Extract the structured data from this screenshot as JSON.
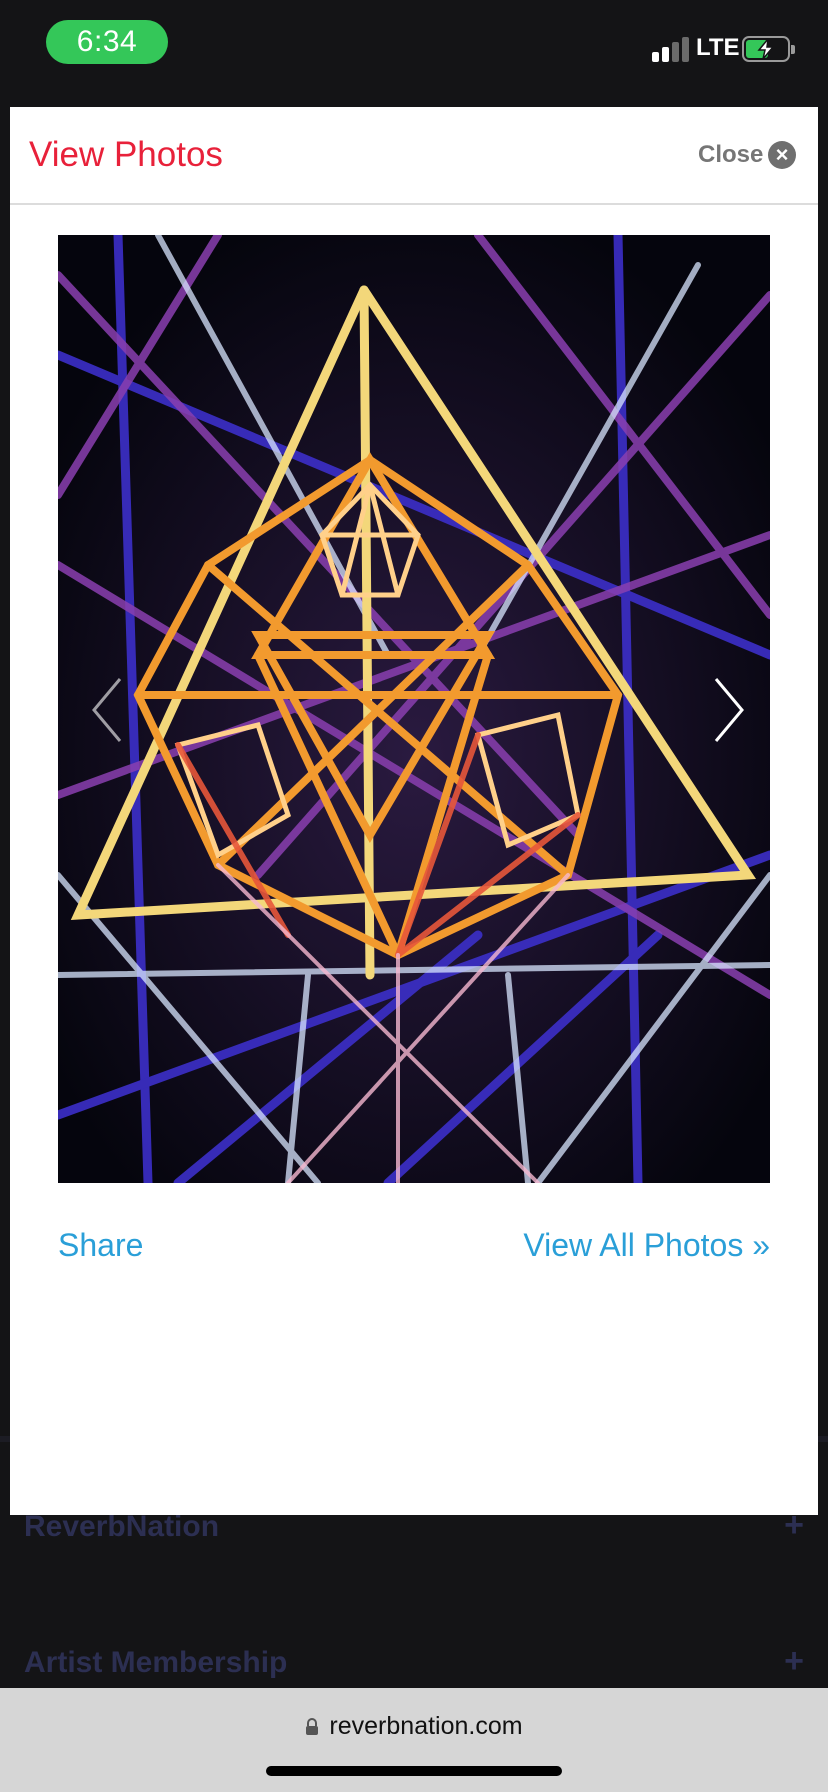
{
  "status_bar": {
    "time": "6:34",
    "network": "LTE",
    "signal_bars_active": 2,
    "battery_charging": true
  },
  "background_page": {
    "sections": [
      {
        "label": "ReverbNation"
      },
      {
        "label": "Artist Membership"
      }
    ],
    "expand_symbol": "+"
  },
  "modal": {
    "title": "View Photos",
    "close_label": "Close",
    "close_symbol": "×",
    "photo_alt": "Photo",
    "share_label": "Share",
    "view_all_label": "View All Photos »"
  },
  "browser": {
    "url": "reverbnation.com"
  },
  "colors": {
    "title_red": "#e8213a",
    "link_blue": "#2a9fd8",
    "time_green": "#34c759"
  }
}
